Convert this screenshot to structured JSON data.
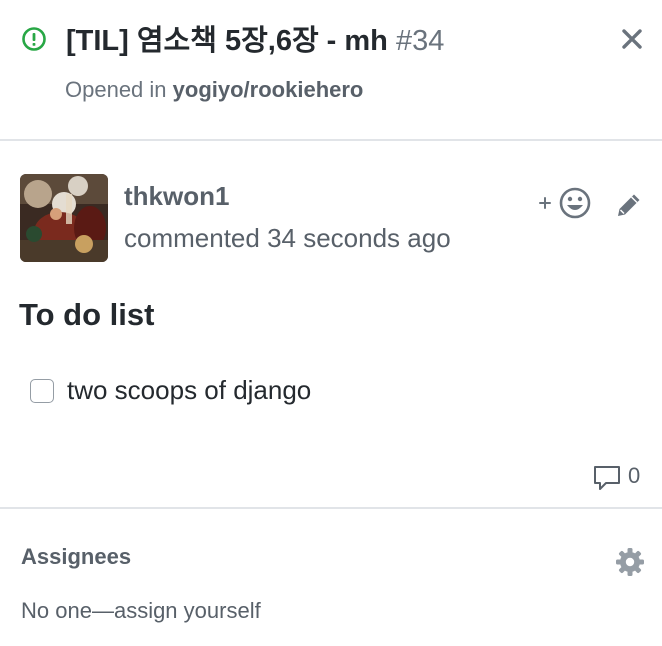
{
  "issue": {
    "status_icon": "issue-opened-icon",
    "status_color": "#28a745",
    "title": "[TIL] 염소책 5장,6장 - mh",
    "number": "#34",
    "opened_in_prefix": "Opened in",
    "repository": "yogiyo/rookiehero",
    "close_icon": "close-icon"
  },
  "comment": {
    "avatar_icon": "avatar",
    "author": "thkwon1",
    "meta": "commented 34 seconds ago",
    "reaction_icon": "add-reaction-icon",
    "reaction_plus": "+",
    "edit_icon": "pencil-icon",
    "heading": "To do list",
    "tasks": [
      {
        "label": "two scoops of django",
        "checked": false
      }
    ],
    "comment_icon": "speech-bubble-icon",
    "comment_count": "0"
  },
  "assignees": {
    "title": "Assignees",
    "settings_icon": "gear-icon",
    "empty_prefix": "No one—",
    "assign_link": "assign yourself"
  },
  "colors": {
    "text": "#24292e",
    "muted": "#586069",
    "divider": "#e1e4e8",
    "open": "#28a745"
  }
}
